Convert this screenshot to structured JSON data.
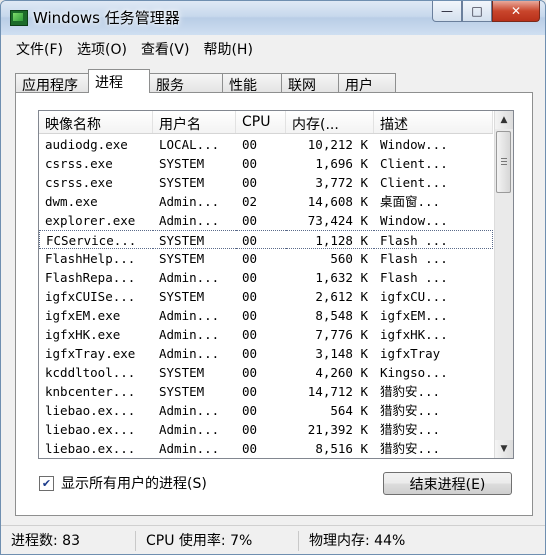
{
  "window": {
    "title": "Windows 任务管理器",
    "caption": {
      "minimize": "—",
      "maximize": "□",
      "close": "✕"
    }
  },
  "menu": [
    "文件(F)",
    "选项(O)",
    "查看(V)",
    "帮助(H)"
  ],
  "tabs": [
    {
      "label": "应用程序",
      "active": false
    },
    {
      "label": "进程",
      "active": true
    },
    {
      "label": "服务",
      "active": false
    },
    {
      "label": "性能",
      "active": false
    },
    {
      "label": "联网",
      "active": false
    },
    {
      "label": "用户",
      "active": false
    }
  ],
  "columns": [
    "映像名称",
    "用户名",
    "CPU",
    "内存(...",
    "描述"
  ],
  "processes": [
    {
      "image": "audiodg.exe",
      "user": "LOCAL...",
      "cpu": "00",
      "memory": "10,212 K",
      "desc": "Window..."
    },
    {
      "image": "csrss.exe",
      "user": "SYSTEM",
      "cpu": "00",
      "memory": "1,696 K",
      "desc": "Client..."
    },
    {
      "image": "csrss.exe",
      "user": "SYSTEM",
      "cpu": "00",
      "memory": "3,772 K",
      "desc": "Client..."
    },
    {
      "image": "dwm.exe",
      "user": "Admin...",
      "cpu": "02",
      "memory": "14,608 K",
      "desc": "桌面窗..."
    },
    {
      "image": "explorer.exe",
      "user": "Admin...",
      "cpu": "00",
      "memory": "73,424 K",
      "desc": "Window..."
    },
    {
      "image": "FCService...",
      "user": "SYSTEM",
      "cpu": "00",
      "memory": "1,128 K",
      "desc": "Flash ...",
      "selected": true
    },
    {
      "image": "FlashHelp...",
      "user": "SYSTEM",
      "cpu": "00",
      "memory": "560 K",
      "desc": "Flash ..."
    },
    {
      "image": "FlashRepa...",
      "user": "Admin...",
      "cpu": "00",
      "memory": "1,632 K",
      "desc": "Flash ..."
    },
    {
      "image": "igfxCUISe...",
      "user": "SYSTEM",
      "cpu": "00",
      "memory": "2,612 K",
      "desc": "igfxCU..."
    },
    {
      "image": "igfxEM.exe",
      "user": "Admin...",
      "cpu": "00",
      "memory": "8,548 K",
      "desc": "igfxEM..."
    },
    {
      "image": "igfxHK.exe",
      "user": "Admin...",
      "cpu": "00",
      "memory": "7,776 K",
      "desc": "igfxHK..."
    },
    {
      "image": "igfxTray.exe",
      "user": "Admin...",
      "cpu": "00",
      "memory": "3,148 K",
      "desc": "igfxTray"
    },
    {
      "image": "kcddltool...",
      "user": "SYSTEM",
      "cpu": "00",
      "memory": "4,260 K",
      "desc": "Kingso..."
    },
    {
      "image": "knbcenter...",
      "user": "SYSTEM",
      "cpu": "00",
      "memory": "14,712 K",
      "desc": "猎豹安..."
    },
    {
      "image": "liebao.ex...",
      "user": "Admin...",
      "cpu": "00",
      "memory": "564 K",
      "desc": "猎豹安..."
    },
    {
      "image": "liebao.ex...",
      "user": "Admin...",
      "cpu": "00",
      "memory": "21,392 K",
      "desc": "猎豹安..."
    },
    {
      "image": "liebao.ex...",
      "user": "Admin...",
      "cpu": "00",
      "memory": "8,516 K",
      "desc": "猎豹安..."
    }
  ],
  "show_all": {
    "label": "显示所有用户的进程(S)",
    "checked": true,
    "check_glyph": "✔"
  },
  "end_process": {
    "label": "结束进程(E)"
  },
  "scroll": {
    "up": "▲",
    "down": "▼"
  },
  "status": {
    "processes": "进程数: 83",
    "cpu": "CPU 使用率: 7%",
    "memory": "物理内存: 44%"
  }
}
